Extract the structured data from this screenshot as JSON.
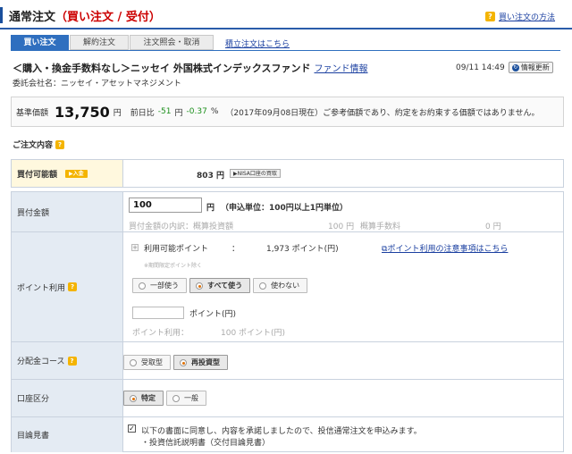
{
  "header": {
    "title": "通常注文",
    "title_highlight": "（買い注文 / 受付）",
    "help_link": "買い注文の方法"
  },
  "tabs": [
    {
      "label": "買い注文",
      "active": true
    },
    {
      "label": "解約注文",
      "active": false
    },
    {
      "label": "注文照会・取消",
      "active": false
    }
  ],
  "tab_link": "積立注文はこちら",
  "fund": {
    "name": "＜購入・換金手数料なし＞ニッセイ 外国株式インデックスファンド",
    "info_link": "ファンド情報",
    "company_label": "委託会社名：",
    "company": "ニッセイ・アセットマネジメント",
    "timestamp": "09/11 14:49",
    "update_button": "情報更新"
  },
  "price": {
    "label": "基準価額",
    "value": "13,750",
    "unit": "円",
    "change_label": "前日比",
    "change": "-51",
    "unit2": "円",
    "change_pct": "-0.37",
    "pct_unit": "%",
    "note": "（2017年09月08日現在）ご参考価額であり、約定をお約束する価額ではありません。"
  },
  "order": {
    "section_title": "ご注文内容",
    "available": {
      "label": "買付可能額",
      "badge": "▶入金",
      "value": "803",
      "unit": "円",
      "nisa_button": "▶NISA口座の買取"
    },
    "amount": {
      "label": "買付金額",
      "value": "100",
      "unit": "円",
      "hint": "（申込単位：100円以上1円単位）",
      "breakdown_label": "買付金額の内訳：概算投資額",
      "invest_value": "100",
      "invest_unit": "円",
      "fee_label": "概算手数料",
      "fee_value": "0",
      "fee_unit": "円"
    },
    "points": {
      "label": "ポイント利用",
      "available_label": "利用可能ポイント",
      "colon": "：",
      "available_value": "1,973 ポイント(円)",
      "note_link": "ポイント利用の注意事項はこちら",
      "limited_note": "※期間限定ポイント除く",
      "options": [
        {
          "label": "一部使う",
          "selected": false
        },
        {
          "label": "すべて使う",
          "selected": true
        },
        {
          "label": "使わない",
          "selected": false
        }
      ],
      "input_unit": "ポイント(円)",
      "usage_label": "ポイント利用：",
      "usage_value": "100 ポイント(円)"
    },
    "distribution": {
      "label": "分配金コース",
      "options": [
        {
          "label": "受取型",
          "selected": false
        },
        {
          "label": "再投資型",
          "selected": true
        }
      ]
    },
    "account": {
      "label": "口座区分",
      "options": [
        {
          "label": "特定",
          "selected": true
        },
        {
          "label": "一般",
          "selected": false
        }
      ]
    },
    "prospectus": {
      "label": "目論見書",
      "checked": "✓",
      "text": "以下の書面に同意し、内容を承諾しましたので、投信通常注文を申込みます。",
      "doc": "・投資信託説明書（交付目論見書）"
    }
  },
  "colors": {
    "accent_blue": "#2f6fbf",
    "highlight_red": "#cc0000",
    "label_bg": "#e4ebf3",
    "help_yellow": "#f4b400"
  }
}
